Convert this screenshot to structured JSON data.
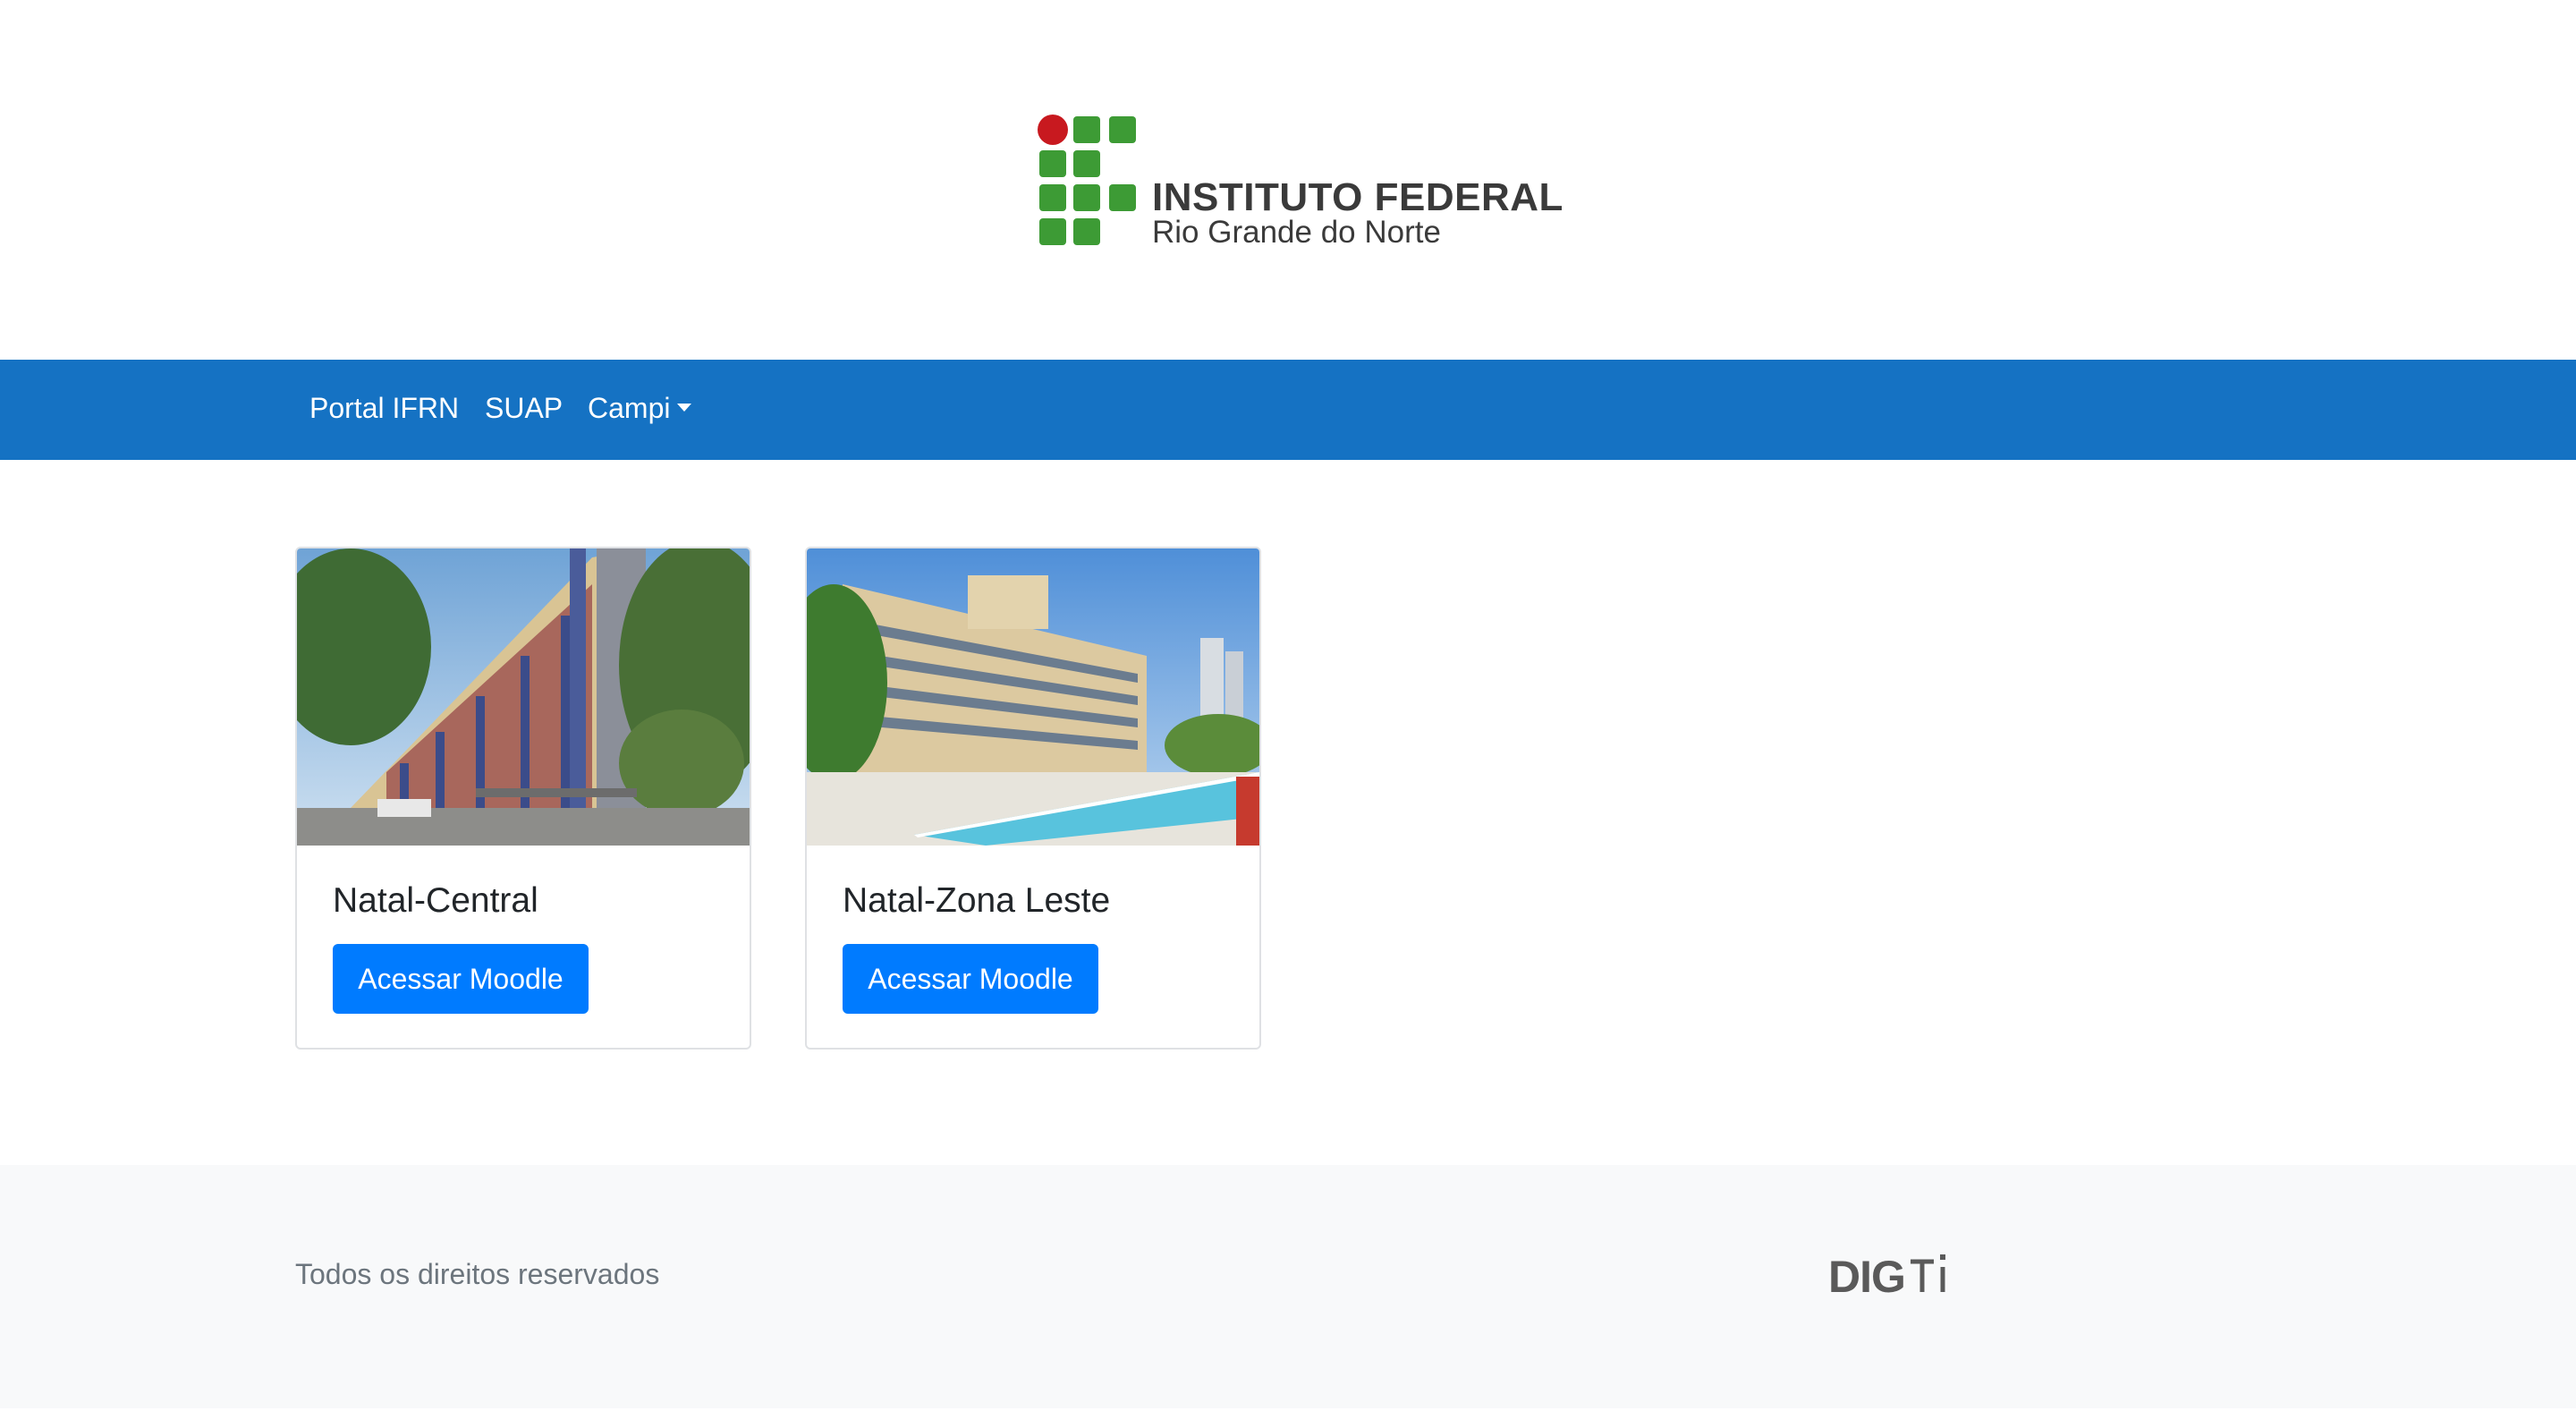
{
  "header": {
    "logo": {
      "name": "ifrn-logo",
      "title": "INSTITUTO FEDERAL",
      "subtitle": "Rio Grande do Norte",
      "colors": {
        "green": "#3d9b35",
        "red": "#c8191f",
        "text": "#3a3a3a"
      }
    }
  },
  "navbar": {
    "background": "#1572c3",
    "items": [
      {
        "label": "Portal IFRN"
      },
      {
        "label": "SUAP"
      },
      {
        "label": "Campi",
        "has_dropdown": true,
        "icon": "caret-down-icon"
      }
    ]
  },
  "cards": [
    {
      "title": "Natal-Central",
      "button_label": "Acessar Moodle",
      "image": "campus-building-photo"
    },
    {
      "title": "Natal-Zona Leste",
      "button_label": "Acessar Moodle",
      "image": "campus-building-pool-photo"
    }
  ],
  "footer": {
    "text": "Todos os direitos reservados",
    "logo": {
      "name": "digti-logo",
      "text": "DIGTI"
    }
  },
  "colors": {
    "primary_button": "#007bff",
    "footer_bg": "#f8f9fa",
    "footer_text": "#6c757d"
  }
}
